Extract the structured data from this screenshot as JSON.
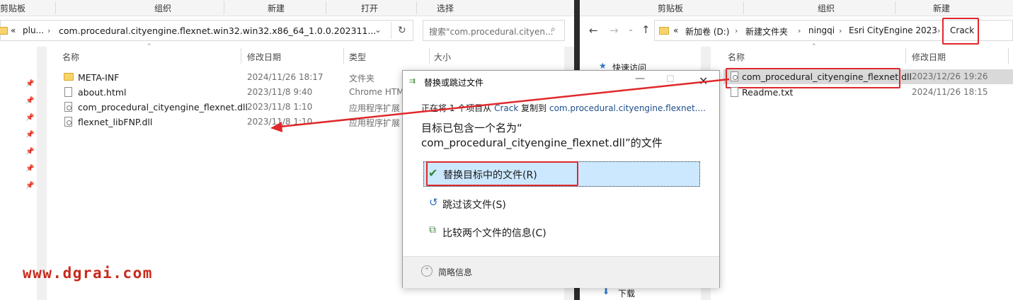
{
  "left_window": {
    "ribbon_groups": [
      "剪贴板",
      "组织",
      "新建",
      "打开",
      "选择"
    ],
    "breadcrumb_prefix": "«",
    "breadcrumb": [
      "plu...",
      "com.procedural.cityengine.flexnet.win32.win32.x86_64_1.0.0.202311..."
    ],
    "search_placeholder": "搜索\"com.procedural.cityen...",
    "columns": [
      "名称",
      "修改日期",
      "类型",
      "大小"
    ],
    "files": [
      {
        "name": "META-INF",
        "date": "2024/11/26 18:17",
        "type": "文件夹",
        "icon": "folder-icon"
      },
      {
        "name": "about.html",
        "date": "2023/11/8 9:40",
        "type": "Chrome HTM",
        "icon": "html-file-icon"
      },
      {
        "name": "com_procedural_cityengine_flexnet.dll",
        "date": "2023/11/8 1:10",
        "type": "应用程序扩展",
        "icon": "dll-file-icon"
      },
      {
        "name": "flexnet_libFNP.dll",
        "date": "2023/11/8 1:10",
        "type": "应用程序扩展",
        "icon": "dll-file-icon"
      }
    ]
  },
  "right_window": {
    "ribbon_groups": [
      "剪贴板",
      "组织",
      "新建"
    ],
    "breadcrumb_prefix": "«",
    "breadcrumb": [
      "新加卷 (D:)",
      "新建文件夹",
      "ningqi",
      "Esri CityEngine 2023",
      "Crack"
    ],
    "nav_quick_access": "快速访问",
    "nav_downloads": "下载",
    "columns": [
      "名称",
      "修改日期"
    ],
    "files": [
      {
        "name": "com_procedural_cityengine_flexnet.dll",
        "date": "2023/12/26 19:26",
        "icon": "dll-file-icon"
      },
      {
        "name": "Readme.txt",
        "date": "2024/11/26 18:15",
        "icon": "text-file-icon"
      }
    ]
  },
  "dialog": {
    "title": "替换或跳过文件",
    "copy_info_prefix": "正在将 1 个项目从",
    "copy_info_source": "Crack",
    "copy_info_mid": "复制到",
    "copy_info_dest": "com.procedural.cityengine.flexnet....",
    "message_line1": "目标已包含一个名为“",
    "message_line2": "com_procedural_cityengine_flexnet.dll”的文件",
    "option_replace": "替换目标中的文件(R)",
    "option_skip": "跳过该文件(S)",
    "option_compare": "比较两个文件的信息(C)",
    "details_toggle": "简略信息"
  },
  "watermark": "www.dgrai.com",
  "colors": {
    "accent_red": "#e0282c",
    "selected_bg": "#cce8ff",
    "watermark": "#c8291c"
  }
}
